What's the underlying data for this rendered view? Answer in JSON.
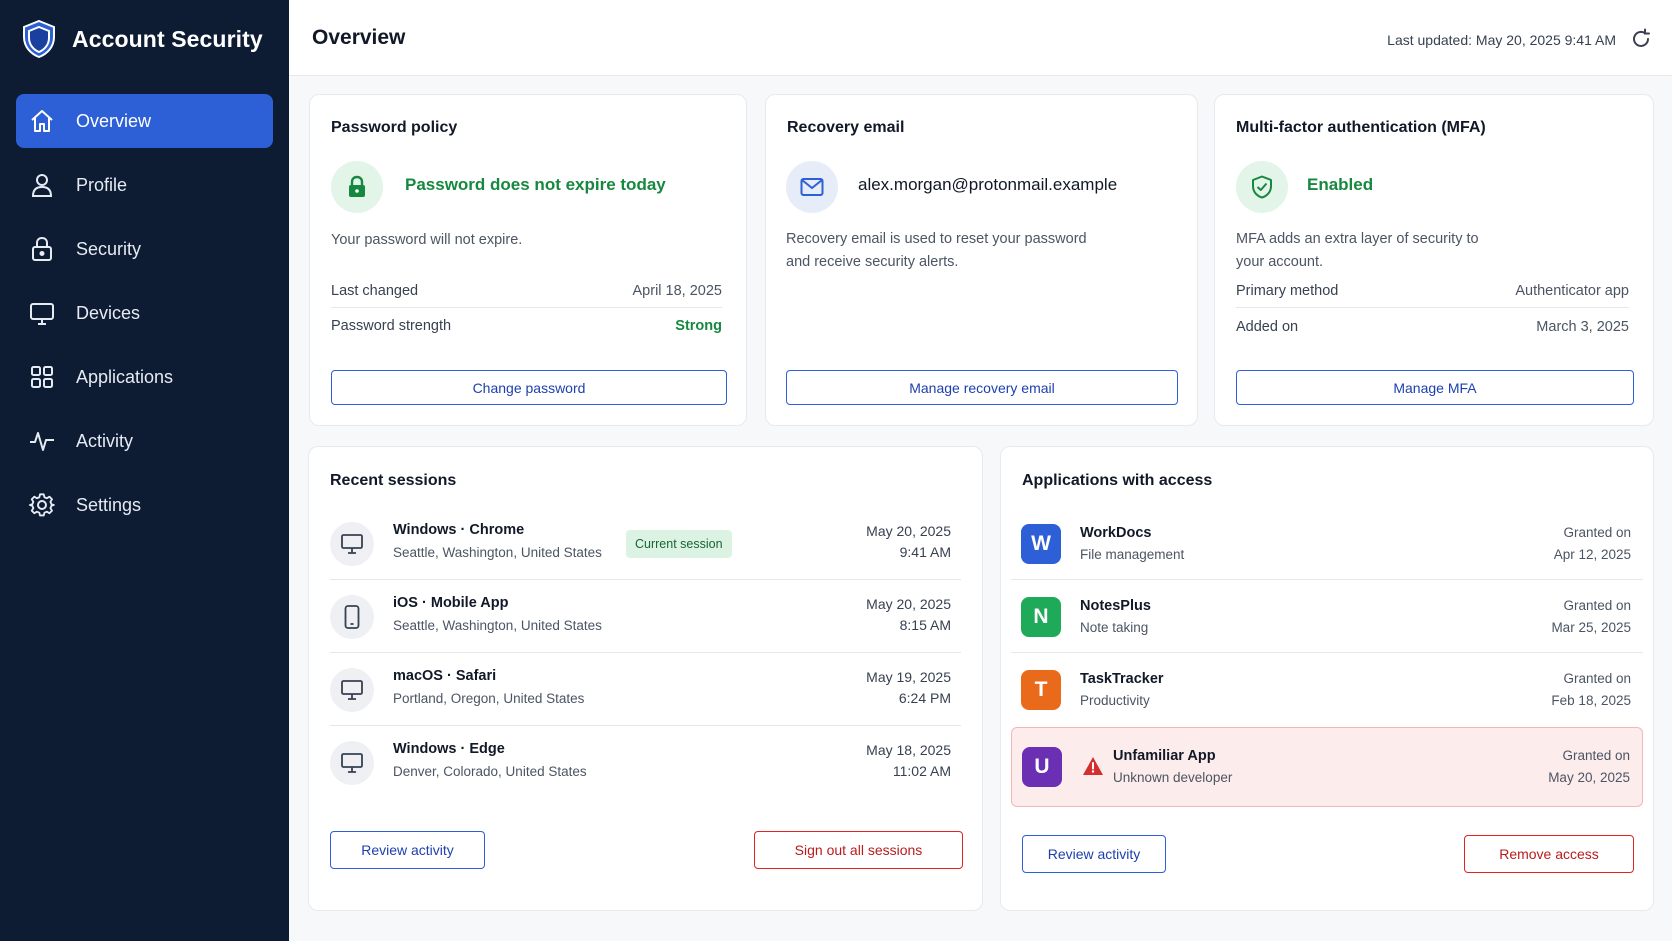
{
  "app": {
    "title": "Account Security"
  },
  "sidebar": {
    "items": [
      {
        "label": "Overview",
        "icon": "home-icon",
        "active": true
      },
      {
        "label": "Profile",
        "icon": "user-icon",
        "active": false
      },
      {
        "label": "Security",
        "icon": "lock-icon",
        "active": false
      },
      {
        "label": "Devices",
        "icon": "monitor-icon",
        "active": false
      },
      {
        "label": "Applications",
        "icon": "grid-icon",
        "active": false
      },
      {
        "label": "Activity",
        "icon": "activity-icon",
        "active": false
      },
      {
        "label": "Settings",
        "icon": "gear-icon",
        "active": false
      }
    ]
  },
  "header": {
    "title": "Overview",
    "last_updated": "Last updated: May 20, 2025 9:41 AM"
  },
  "password_policy": {
    "title": "Password policy",
    "status": "Password does not expire today",
    "description": "Your password will not expire.",
    "last_changed_label": "Last changed",
    "last_changed_value": "April 18, 2025",
    "strength_label": "Password strength",
    "strength_value": "Strong",
    "button": "Change password"
  },
  "recovery_email": {
    "title": "Recovery email",
    "email": "alex.morgan@protonmail.example",
    "description_line1": "Recovery email is used to reset your password",
    "description_line2": "and receive security alerts.",
    "button": "Manage recovery email"
  },
  "mfa": {
    "title": "Multi-factor authentication (MFA)",
    "status": "Enabled",
    "description_line1": "MFA adds an extra layer of security to",
    "description_line2": "your account.",
    "primary_label": "Primary method",
    "primary_value": "Authenticator app",
    "added_label": "Added on",
    "added_value": "March 3, 2025",
    "button": "Manage MFA"
  },
  "sessions": {
    "title": "Recent sessions",
    "current_badge": "Current session",
    "rows": [
      {
        "device": "Windows · Chrome",
        "location": "Seattle, Washington, United States",
        "date": "May 20, 2025",
        "time": "9:41 AM",
        "icon": "monitor-icon"
      },
      {
        "device": "iOS · Mobile App",
        "location": "Seattle, Washington, United States",
        "date": "May 20, 2025",
        "time": "8:15 AM",
        "icon": "phone-icon"
      },
      {
        "device": "macOS · Safari",
        "location": "Portland, Oregon, United States",
        "date": "May 19, 2025",
        "time": "6:24 PM",
        "icon": "monitor-icon"
      },
      {
        "device": "Windows · Edge",
        "location": "Denver, Colorado, United States",
        "date": "May 18, 2025",
        "time": "11:02 AM",
        "icon": "monitor-icon"
      }
    ],
    "review_button": "Review activity",
    "signout_button": "Sign out all sessions"
  },
  "applications": {
    "title": "Applications with access",
    "granted_label": "Granted on",
    "rows": [
      {
        "letter": "W",
        "name": "WorkDocs",
        "category": "File management",
        "granted": "Apr 12, 2025",
        "color": "#2d5fd6"
      },
      {
        "letter": "N",
        "name": "NotesPlus",
        "category": "Note taking",
        "granted": "Mar 25, 2025",
        "color": "#1faa59"
      },
      {
        "letter": "T",
        "name": "TaskTracker",
        "category": "Productivity",
        "granted": "Feb 18, 2025",
        "color": "#ea6a1b"
      },
      {
        "letter": "U",
        "name": "Unfamiliar App",
        "category": "Unknown developer",
        "granted": "May 20, 2025",
        "color": "#6b2fb3",
        "warning": true
      }
    ],
    "review_button": "Review activity",
    "remove_button": "Remove access"
  },
  "colors": {
    "sidebar_bg": "#0d1b33",
    "accent": "#2d5fd6",
    "success": "#16883f",
    "danger": "#dc2626"
  }
}
